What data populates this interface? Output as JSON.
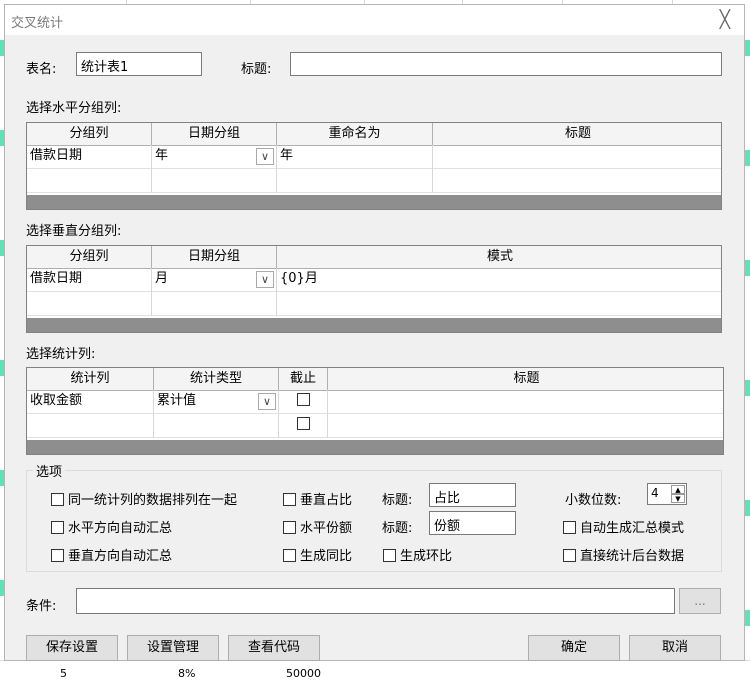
{
  "background": {
    "cells": [
      "5",
      "8%",
      "50000"
    ]
  },
  "dialog": {
    "title": "交叉统计",
    "close_glyph": "╳"
  },
  "table_name": {
    "label": "表名:",
    "value": "统计表1"
  },
  "title_field": {
    "label": "标题:",
    "value": ""
  },
  "horizontal": {
    "section_label": "选择水平分组列:",
    "headers": [
      "分组列",
      "日期分组",
      "重命名为",
      "标题"
    ],
    "rows": [
      {
        "col": "借款日期",
        "date_group": "年",
        "rename": "年",
        "title": ""
      }
    ]
  },
  "vertical": {
    "section_label": "选择垂直分组列:",
    "headers": [
      "分组列",
      "日期分组",
      "模式"
    ],
    "rows": [
      {
        "col": "借款日期",
        "date_group": "月",
        "pattern": "{0}月"
      }
    ]
  },
  "stats": {
    "section_label": "选择统计列:",
    "headers": [
      "统计列",
      "统计类型",
      "截止",
      "标题"
    ],
    "rows": [
      {
        "col": "收取金额",
        "type": "累计值",
        "cutoff": false,
        "title": ""
      }
    ]
  },
  "options": {
    "group_label": "选项",
    "same_row": "同一统计列的数据排列在一起",
    "h_auto_sum": "水平方向自动汇总",
    "v_auto_sum": "垂直方向自动汇总",
    "v_ratio": "垂直占比",
    "h_share": "水平份额",
    "gen_yoy": "生成同比",
    "gen_mom": "生成环比",
    "title_label_1": "标题:",
    "title_label_2": "标题:",
    "ratio_title": "占比",
    "share_title": "份额",
    "decimals_label": "小数位数:",
    "decimals_value": "4",
    "auto_summary_mode": "自动生成汇总模式",
    "direct_backend": "直接统计后台数据"
  },
  "condition": {
    "label": "条件:",
    "value": "",
    "browse": "..."
  },
  "buttons": {
    "save": "保存设置",
    "manage": "设置管理",
    "view_code": "查看代码",
    "ok": "确定",
    "cancel": "取消"
  }
}
